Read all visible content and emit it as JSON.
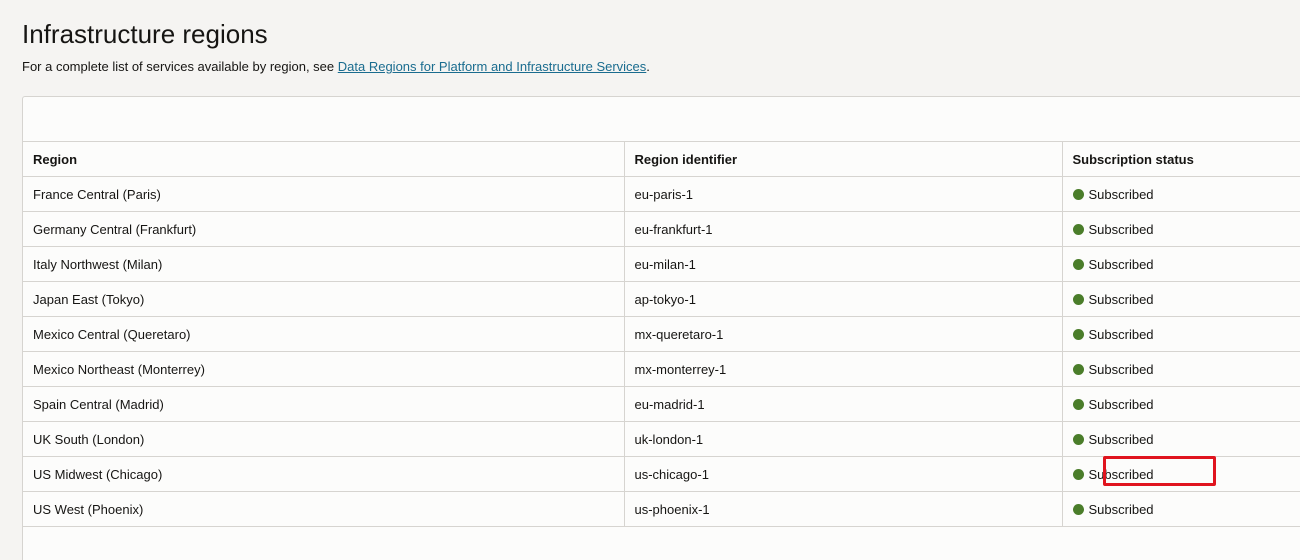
{
  "page": {
    "title": "Infrastructure regions",
    "subtitle_prefix": "For a complete list of services available by region, see ",
    "subtitle_link": "Data Regions for Platform and Infrastructure Services",
    "subtitle_suffix": "."
  },
  "table": {
    "columns": [
      "Region",
      "Region identifier",
      "Subscription status"
    ],
    "status_color": "#4a7d2a",
    "highlight_color": "#e0141e",
    "rows": [
      {
        "region": "France Central (Paris)",
        "identifier": "eu-paris-1",
        "status": "Subscribed"
      },
      {
        "region": "Germany Central (Frankfurt)",
        "identifier": "eu-frankfurt-1",
        "status": "Subscribed"
      },
      {
        "region": "Italy Northwest (Milan)",
        "identifier": "eu-milan-1",
        "status": "Subscribed"
      },
      {
        "region": "Japan East (Tokyo)",
        "identifier": "ap-tokyo-1",
        "status": "Subscribed"
      },
      {
        "region": "Mexico Central (Queretaro)",
        "identifier": "mx-queretaro-1",
        "status": "Subscribed"
      },
      {
        "region": "Mexico Northeast (Monterrey)",
        "identifier": "mx-monterrey-1",
        "status": "Subscribed"
      },
      {
        "region": "Spain Central (Madrid)",
        "identifier": "eu-madrid-1",
        "status": "Subscribed"
      },
      {
        "region": "UK South (London)",
        "identifier": "uk-london-1",
        "status": "Subscribed"
      },
      {
        "region": "US Midwest (Chicago)",
        "identifier": "us-chicago-1",
        "status": "Subscribed",
        "highlighted": true
      },
      {
        "region": "US West (Phoenix)",
        "identifier": "us-phoenix-1",
        "status": "Subscribed"
      }
    ]
  }
}
